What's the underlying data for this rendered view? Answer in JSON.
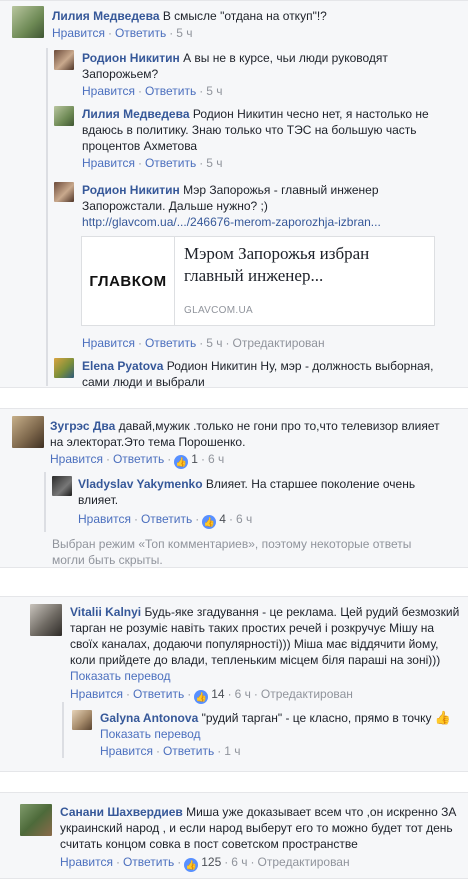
{
  "actions": {
    "like": "Нравится",
    "reply": "Ответить",
    "sep": "·"
  },
  "block1": {
    "c1": {
      "author": "Лилия Медведева",
      "text": "В смысле \"отдана на откуп\"!?",
      "time": "5 ч"
    },
    "c2": {
      "author": "Родион Никитин",
      "text": "А вы не в курсе, чьи люди руководят Запорожьем?",
      "time": "5 ч"
    },
    "c3": {
      "author": "Лилия Медведева",
      "text": "Родион Никитин чесно нет, я настолько не вдаюсь в политику. Знаю только что ТЭС на большую часть процентов Ахметова",
      "time": "5 ч"
    },
    "c4": {
      "author": "Родион Никитин",
      "text": "Мэр Запорожья - главный инженер Запорожстали. Дальше нужно? ;)",
      "link": "http://glavcom.ua/.../246676-merom-zaporozhja-izbran...",
      "time": "5 ч",
      "edited": "Отредактирован"
    },
    "preview": {
      "logo": "ГЛАВКОМ",
      "title": "Мэром Запорожья избран главный инженер...",
      "source": "GLAVCOM.UA"
    },
    "c5": {
      "author": "Elena Pyatova",
      "text": "Родион Никитин Ну, мэр - должность выборная, сами люди и выбрали"
    }
  },
  "block2": {
    "c1": {
      "author": "Зугрэс Два",
      "text": "давай,мужик .только не гони про то,что телевизор влияет на электорат.Это тема Порошенко.",
      "likes": "1",
      "time": "6 ч"
    },
    "c2": {
      "author": "Vladyslav Yakymenko",
      "text": "Влияет. На старшее поколение очень влияет.",
      "likes": "4",
      "time": "6 ч"
    },
    "note": "Выбран режим «Топ комментариев», поэтому некоторые ответы могли быть скрыты."
  },
  "block3": {
    "c1": {
      "author": "Vitalii Kalnyi",
      "text": "Будь-яке згадування - це реклама. Цей рудий безмозкий тарган не розуміє навіть таких простих речей і розкручує Мішу на своїх каналах, додаючи популярності))) Міша має віддячити йому, коли прийдете до влади, тепленьким місцем біля параші на зоні)))",
      "translate": "Показать перевод",
      "likes": "14",
      "time": "6 ч",
      "edited": "Отредактирован"
    },
    "c2": {
      "author": "Galyna Antonova",
      "text": "\"рудий тарган\" - це класно, прямо в точку",
      "emoji": "👍",
      "translate": "Показать перевод",
      "time": "1 ч"
    }
  },
  "block4": {
    "c1": {
      "author": "Санани Шахвердиев",
      "text": "Миша уже доказывает всем что ,он искренно ЗА украинский народ , и если народ выберут его то можно будет тот день считать концом совка в пост советском пространстве",
      "likes": "125",
      "time": "6 ч",
      "edited": "Отредактирован"
    }
  },
  "colors": {
    "link": "#365899",
    "meta": "#90949c",
    "like": "#5890ff",
    "panel": "#f6f7f9"
  }
}
